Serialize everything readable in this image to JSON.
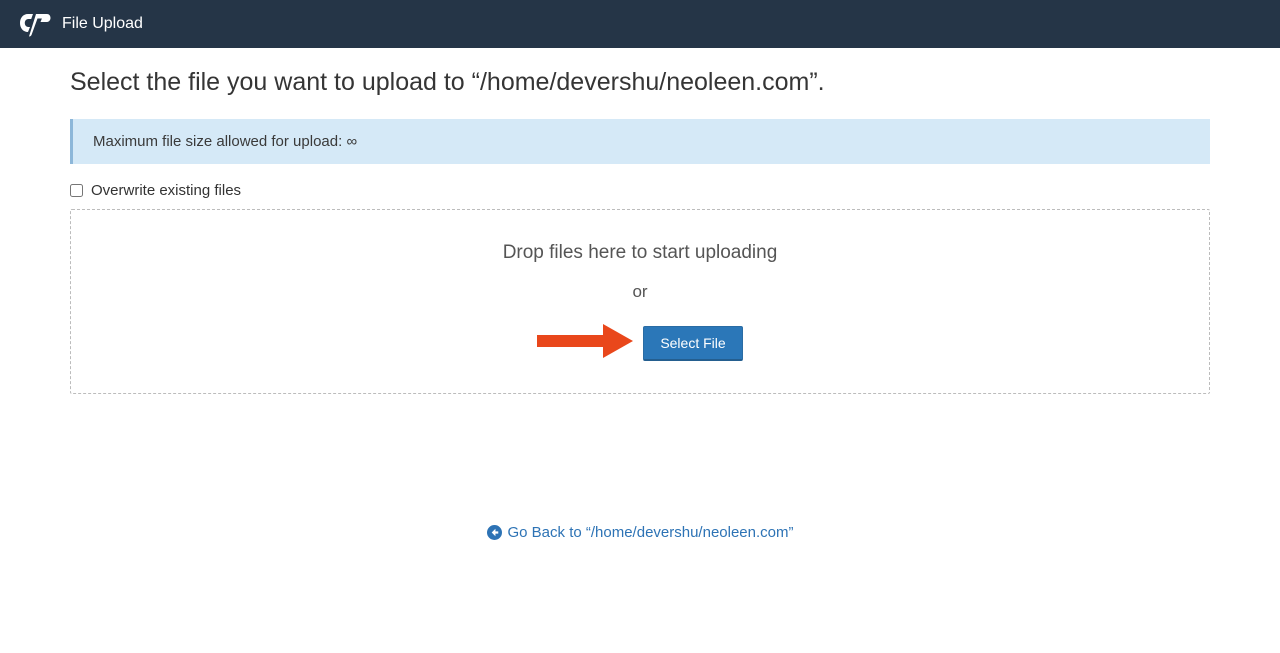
{
  "header": {
    "title": "File Upload"
  },
  "page": {
    "heading": "Select the file you want to upload to “/home/devershu/neoleen.com”.",
    "info_banner": "Maximum file size allowed for upload: ∞",
    "overwrite_label": "Overwrite existing files",
    "dropzone": {
      "drop_text": "Drop files here to start uploading",
      "or_text": "or",
      "select_file_label": "Select File"
    },
    "goback_label": "Go Back to “/home/devershu/neoleen.com”"
  }
}
